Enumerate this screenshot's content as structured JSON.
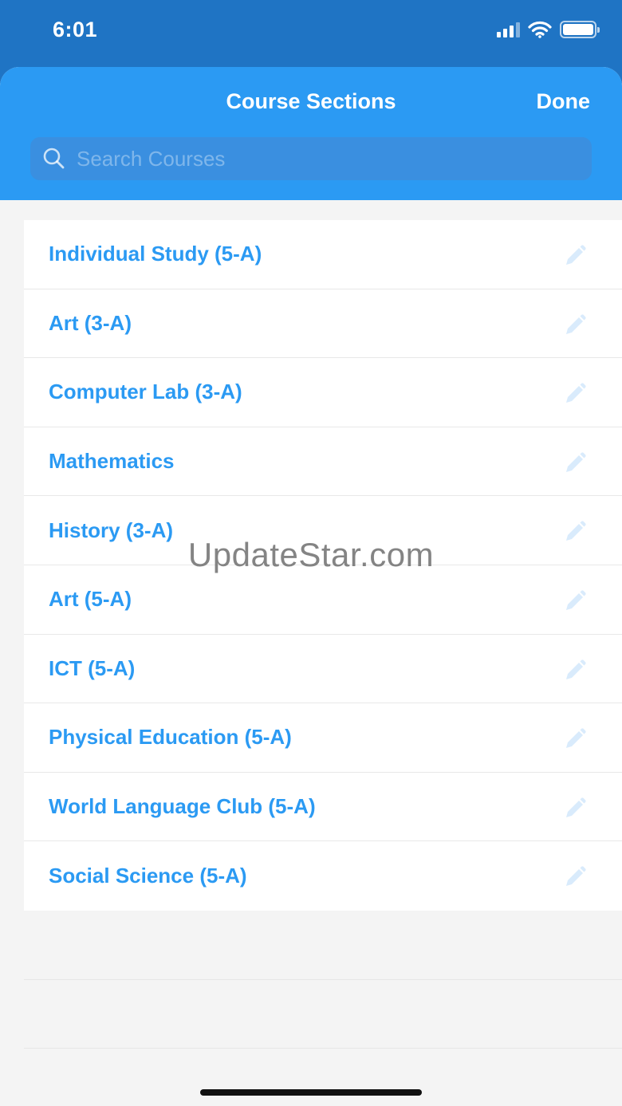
{
  "status_bar": {
    "time": "6:01"
  },
  "header": {
    "title": "Course Sections",
    "done_label": "Done"
  },
  "search": {
    "placeholder": "Search Courses",
    "value": ""
  },
  "courses": [
    {
      "label": "Individual Study (5-A)"
    },
    {
      "label": "Art (3-A)"
    },
    {
      "label": "Computer Lab (3-A)"
    },
    {
      "label": "Mathematics"
    },
    {
      "label": "History (3-A)"
    },
    {
      "label": "Art (5-A)"
    },
    {
      "label": "ICT (5-A)"
    },
    {
      "label": "Physical Education (5-A)"
    },
    {
      "label": "World Language Club (5-A)"
    },
    {
      "label": "Social Science (5-A)"
    }
  ],
  "watermark": "UpdateStar.com",
  "icons": {
    "search": "search-icon",
    "edit": "pencil-icon",
    "signal": "cellular-signal-icon",
    "wifi": "wifi-icon",
    "battery": "battery-icon"
  },
  "colors": {
    "status_bar_bg": "#1f74c4",
    "header_bg": "#2b9af3",
    "accent": "#2b9af3",
    "list_bg": "#ffffff",
    "page_bg": "#f4f4f4"
  }
}
